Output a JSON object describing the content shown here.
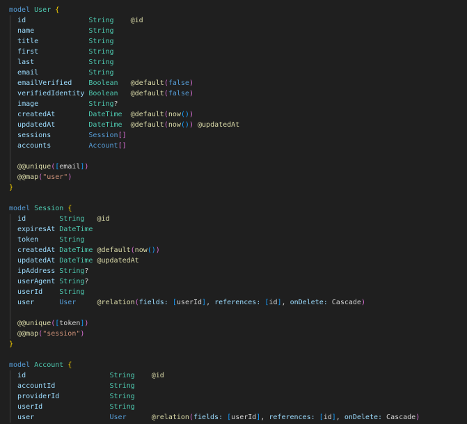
{
  "colors": {
    "background": "#1f1f1f",
    "keyword": "#569cd6",
    "type": "#4ec9b0",
    "field": "#9cdcfe",
    "attribute": "#dcdcaa",
    "string": "#ce9178",
    "bracket_1": "#ffd700",
    "bracket_2": "#da70d6",
    "bracket_3": "#179fff"
  },
  "models": [
    {
      "keyword": "model",
      "name": "User",
      "fields": [
        {
          "name": "id",
          "type": "String",
          "attrs": "@id"
        },
        {
          "name": "name",
          "type": "String",
          "attrs": ""
        },
        {
          "name": "title",
          "type": "String",
          "attrs": ""
        },
        {
          "name": "first",
          "type": "String",
          "attrs": ""
        },
        {
          "name": "last",
          "type": "String",
          "attrs": ""
        },
        {
          "name": "email",
          "type": "String",
          "attrs": ""
        },
        {
          "name": "emailVerified",
          "type": "Boolean",
          "attrs": "@default(false)"
        },
        {
          "name": "verifiedIdentity",
          "type": "Boolean",
          "attrs": "@default(false)"
        },
        {
          "name": "image",
          "type": "String?",
          "attrs": ""
        },
        {
          "name": "createdAt",
          "type": "DateTime",
          "attrs": "@default(now())"
        },
        {
          "name": "updatedAt",
          "type": "DateTime",
          "attrs": "@default(now()) @updatedAt"
        },
        {
          "name": "sessions",
          "type": "Session[]",
          "attrs": ""
        },
        {
          "name": "accounts",
          "type": "Account[]",
          "attrs": ""
        }
      ],
      "block_attrs": [
        "@@unique([email])",
        "@@map(\"user\")"
      ]
    },
    {
      "keyword": "model",
      "name": "Session",
      "fields": [
        {
          "name": "id",
          "type": "String",
          "attrs": "@id"
        },
        {
          "name": "expiresAt",
          "type": "DateTime",
          "attrs": ""
        },
        {
          "name": "token",
          "type": "String",
          "attrs": ""
        },
        {
          "name": "createdAt",
          "type": "DateTime",
          "attrs": "@default(now())"
        },
        {
          "name": "updatedAt",
          "type": "DateTime",
          "attrs": "@updatedAt"
        },
        {
          "name": "ipAddress",
          "type": "String?",
          "attrs": ""
        },
        {
          "name": "userAgent",
          "type": "String?",
          "attrs": ""
        },
        {
          "name": "userId",
          "type": "String",
          "attrs": ""
        },
        {
          "name": "user",
          "type": "User",
          "attrs": "@relation(fields: [userId], references: [id], onDelete: Cascade)"
        }
      ],
      "block_attrs": [
        "@@unique([token])",
        "@@map(\"session\")"
      ]
    },
    {
      "keyword": "model",
      "name": "Account",
      "fields": [
        {
          "name": "id",
          "type": "String",
          "attrs": "@id"
        },
        {
          "name": "accountId",
          "type": "String",
          "attrs": ""
        },
        {
          "name": "providerId",
          "type": "String",
          "attrs": ""
        },
        {
          "name": "userId",
          "type": "String",
          "attrs": ""
        },
        {
          "name": "user",
          "type": "User",
          "attrs": "@relation(fields: [userId], references: [id], onDelete: Cascade)"
        }
      ],
      "block_attrs": []
    }
  ]
}
